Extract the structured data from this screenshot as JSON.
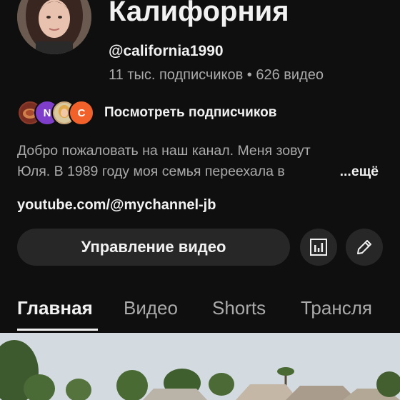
{
  "channel": {
    "title": "Калифорния",
    "handle": "@california1990",
    "stats": "11 тыс. подписчиков • 626 видео",
    "view_subscribers_label": "Посмотреть подписчиков",
    "subscriber_avatars": [
      {
        "letter": "",
        "color": "#8b3a2a"
      },
      {
        "letter": "N",
        "color": "#7e3ec9"
      },
      {
        "letter": "",
        "color": "#c9a77a"
      },
      {
        "letter": "C",
        "color": "#f2612a"
      }
    ],
    "description_line1": "Добро пожаловать на наш канал. Меня зовут",
    "description_line2": "Юля. В 1989 году моя семья переехала в",
    "more_label": "...ещё",
    "link": "youtube.com/@mychannel-jb"
  },
  "actions": {
    "manage_videos_label": "Управление видео",
    "analytics_icon": "bar-chart-icon",
    "edit_icon": "pencil-icon"
  },
  "tabs": [
    {
      "label": "Главная",
      "active": true
    },
    {
      "label": "Видео",
      "active": false
    },
    {
      "label": "Shorts",
      "active": false
    },
    {
      "label": "Трансля",
      "active": false
    }
  ],
  "colors": {
    "background": "#0f0f0f",
    "button": "#272727",
    "text_primary": "#f1f1f1",
    "text_secondary": "#aaaaaa"
  }
}
